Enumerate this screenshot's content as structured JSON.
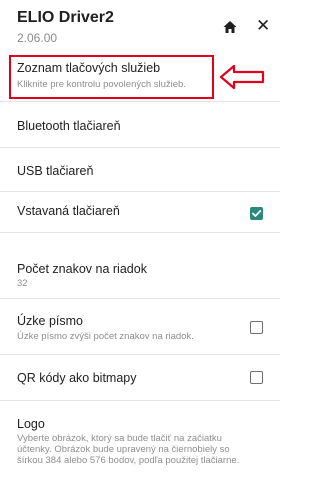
{
  "header": {
    "title": "ELIO Driver2",
    "version": "2.06.00",
    "home_icon": "home-icon",
    "close_icon": "close-icon",
    "close_glyph": "✕"
  },
  "settings": [
    {
      "title": "Zoznam tlačových služieb",
      "subtitle": "Kliknite pre kontrolu povolených služieb."
    },
    {
      "title": "Bluetooth tlačiareň"
    },
    {
      "title": "USB tlačiareň"
    },
    {
      "title": "Vstavaná tlačiareň",
      "checked": true
    },
    {
      "title": "Počet znakov na riadok",
      "subtitle": "32"
    },
    {
      "title": "Úzke písmo",
      "subtitle": "Úzke písmo zvýši počet znakov na riadok.",
      "checked": false
    },
    {
      "title": "QR kódy ako bitmapy",
      "checked": false
    },
    {
      "title": "Logo",
      "subtitle": "Vyberte obrázok, ktorý sa bude tlačiť na začiatku účtenky. Obrázok bude upravený na čiernobiely so šírkou 384 alebo 576 bodov, podľa použitej tlačiarne."
    }
  ],
  "colors": {
    "highlight": "#e0001b",
    "checkbox_checked": "#2a8a7a",
    "checkbox_unchecked": "#6f6f6f"
  }
}
